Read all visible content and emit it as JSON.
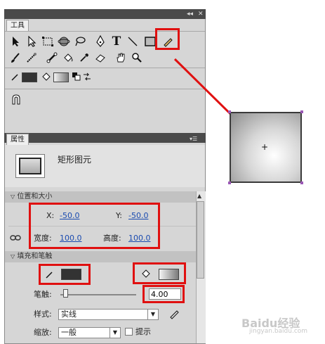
{
  "panel": {
    "collapse_glyph": "◂◂",
    "close_glyph": "✕"
  },
  "tools_tab": {
    "label": "工具"
  },
  "tool_icons": [
    "arrow",
    "subselect",
    "free-transform",
    "3d-rotate",
    "lasso",
    "pen",
    "text",
    "line",
    "rectangle",
    "pencil",
    "brush",
    "deco",
    "bone",
    "paint-bucket",
    "eyedropper",
    "eraser",
    "hand",
    "zoom"
  ],
  "colors": {
    "stroke_swatch": "#333333",
    "accent_red": "#e01010",
    "link_blue": "#1a4bb0"
  },
  "properties": {
    "tab_label": "属性",
    "object_type": "矩形图元",
    "sections": {
      "position_size": "位置和大小",
      "fill_stroke": "填充和笔触"
    },
    "x_label": "X:",
    "x_value": "-50.0",
    "y_label": "Y:",
    "y_value": "-50.0",
    "width_label": "宽度:",
    "width_value": "100.0",
    "height_label": "高度:",
    "height_value": "100.0",
    "stroke_label": "笔触:",
    "stroke_value": "4.00",
    "stroke_slider_fraction": 0.04,
    "style_label": "样式:",
    "style_value": "实线",
    "scale_label": "缩放:",
    "scale_value": "一般",
    "hint_label": "提示"
  },
  "watermark": {
    "text": "Baidu经验",
    "sub": "jingyan.baidu.com"
  }
}
